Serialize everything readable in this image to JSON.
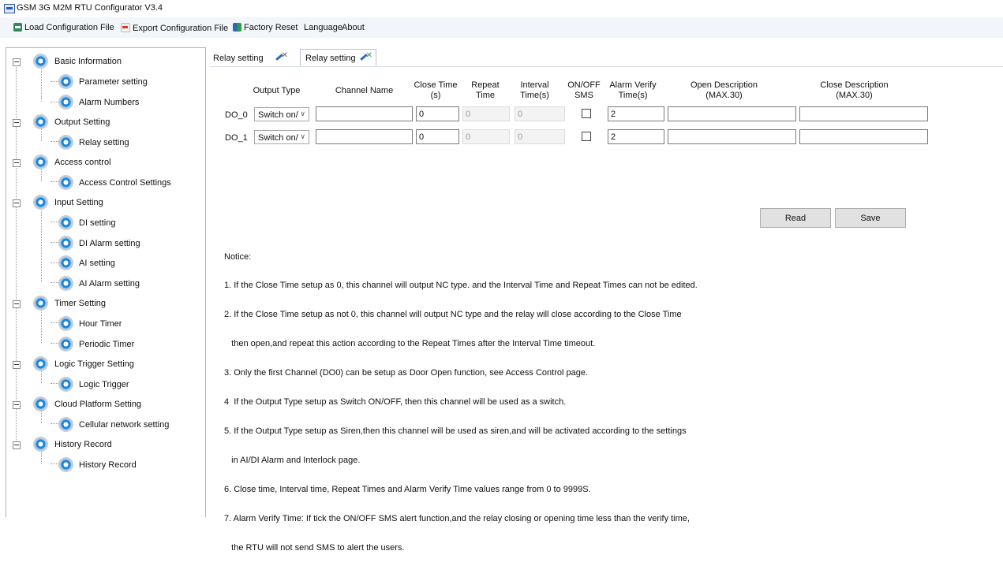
{
  "window": {
    "title": "GSM 3G M2M RTU Configurator V3.4"
  },
  "menu": {
    "load": "Load Configuration File",
    "export": "Export Configuration File",
    "reset": "Factory Reset",
    "language": "Language",
    "about": "About"
  },
  "tree": {
    "basic_information": "Basic Information",
    "parameter_setting": "Parameter setting",
    "alarm_numbers": "Alarm Numbers",
    "output_setting": "Output Setting",
    "relay_setting": "Relay setting",
    "access_control": "Access control",
    "access_control_settings": "Access Control Settings",
    "input_setting": "Input Setting",
    "di_setting": "DI setting",
    "di_alarm_setting": "DI Alarm setting",
    "ai_setting": "AI setting",
    "ai_alarm_setting": "AI Alarm setting",
    "timer_setting": "Timer Setting",
    "hour_timer": "Hour Timer",
    "periodic_timer": "Periodic Timer",
    "logic_trigger_setting": "Logic Trigger Setting",
    "logic_trigger": "Logic Trigger",
    "cloud_platform_setting": "Cloud Platform Setting",
    "cellular_network_setting": "Cellular network setting",
    "history_record_group": "History Record",
    "history_record": "History Record"
  },
  "tabs": [
    "Relay setting",
    "Relay setting"
  ],
  "table": {
    "headers": {
      "output_type": "Output Type",
      "channel_name": "Channel Name",
      "close_time": "Close Time\n(s)",
      "repeat_time": "Repeat\nTime",
      "interval_time": "Interval\nTime(s)",
      "onoff_sms": "ON/OFF\nSMS",
      "alarm_verify": "Alarm Verify\nTime(s)",
      "open_desc": "Open Description\n(MAX.30)",
      "close_desc": "Close Description\n(MAX.30)"
    },
    "rows": [
      {
        "label": "DO_0",
        "output_type": "Switch on/",
        "channel_name": "",
        "close_time": "0",
        "repeat_time": "0",
        "interval_time": "0",
        "sms": false,
        "alarm_verify": "2",
        "open_desc": "",
        "close_desc": ""
      },
      {
        "label": "DO_1",
        "output_type": "Switch on/",
        "channel_name": "",
        "close_time": "0",
        "repeat_time": "0",
        "interval_time": "0",
        "sms": false,
        "alarm_verify": "2",
        "open_desc": "",
        "close_desc": ""
      }
    ]
  },
  "buttons": {
    "read": "Read",
    "save": "Save"
  },
  "notice": {
    "title": "Notice:",
    "lines": [
      "1. If the Close Time setup as 0, this channel will output NC type. and the Interval Time and Repeat Times can not be edited.",
      "2. If the Close Time setup as not 0, this channel will output NC type and the relay will close according to the Close Time",
      "   then open,and repeat this action according to the Repeat Times after the Interval Time timeout.",
      "3. Only the first Channel (DO0) can be setup as Door Open function, see Access Control page.",
      "4  If the Output Type setup as Switch ON/OFF, then this channel will be used as a switch.",
      "5. If the Output Type setup as Siren,then this channel will be used as siren,and will be activated according to the settings",
      "   in AI/DI Alarm and Interlock page.",
      "6. Close time, Interval time, Repeat Times and Alarm Verify Time values range from 0 to 9999S.",
      "7. Alarm Verify Time: If tick the ON/OFF SMS alert function,and the relay closing or opening time less than the verify time,",
      "   the RTU will not send SMS to alert the users."
    ]
  }
}
